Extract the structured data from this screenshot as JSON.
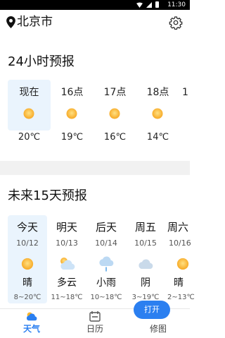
{
  "status_bar": {
    "time": "11:30"
  },
  "header": {
    "location": "北京市"
  },
  "hourly": {
    "title": "24小时预报",
    "items": [
      {
        "label": "现在",
        "temp": "20℃",
        "icon": "sunny-icon"
      },
      {
        "label": "16点",
        "temp": "19℃",
        "icon": "sunny-icon"
      },
      {
        "label": "17点",
        "temp": "16℃",
        "icon": "sunny-icon"
      },
      {
        "label": "18点",
        "temp": "14℃",
        "icon": "sunny-icon"
      },
      {
        "label": "1",
        "temp": "",
        "icon": ""
      }
    ]
  },
  "daily": {
    "title": "未来15天预报",
    "items": [
      {
        "day": "今天",
        "date": "10/12",
        "cond": "晴",
        "range": "8~20℃",
        "icon": "sunny-icon"
      },
      {
        "day": "明天",
        "date": "10/13",
        "cond": "多云",
        "range": "11~18℃",
        "icon": "partly-cloudy-icon"
      },
      {
        "day": "后天",
        "date": "10/14",
        "cond": "小雨",
        "range": "10~18℃",
        "icon": "light-rain-icon"
      },
      {
        "day": "周五",
        "date": "10/15",
        "cond": "阴",
        "range": "3~19℃",
        "icon": "overcast-icon"
      },
      {
        "day": "周六",
        "date": "10/16",
        "cond": "晴",
        "range": "2~13℃",
        "icon": "sunny-icon"
      }
    ]
  },
  "fab": {
    "label": "打开"
  },
  "nav": [
    {
      "label": "天气",
      "icon": "weather-icon"
    },
    {
      "label": "日历",
      "icon": "calendar-icon"
    },
    {
      "label": "修图",
      "icon": "photo-edit-icon"
    }
  ],
  "colors": {
    "accent": "#2b7ff0",
    "selected_bg": "#eaf4fd",
    "sun": "#f7b52b",
    "divider": "#f1f1f1"
  }
}
